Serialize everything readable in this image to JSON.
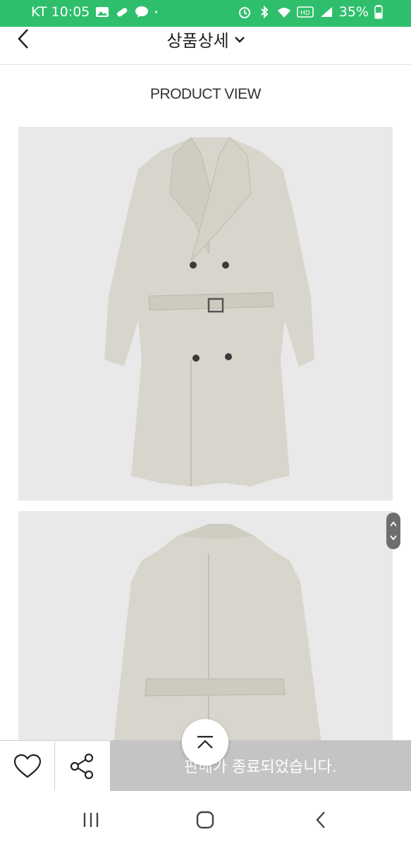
{
  "status_bar": {
    "carrier_time": "KT 10:05",
    "battery": "35%",
    "left_icons": [
      "gallery-icon",
      "pill-icon",
      "kakaotalk-icon",
      "dot-icon"
    ],
    "right_icons": [
      "alarm-icon",
      "bluetooth-icon",
      "wifi-icon",
      "hd-icon",
      "signal-icon",
      "battery-icon"
    ],
    "background": "#2fbf6c"
  },
  "header": {
    "title": "상품상세",
    "back_icon": "chevron-left-icon",
    "dropdown_icon": "chevron-down-icon"
  },
  "main": {
    "section_label": "PRODUCT VIEW",
    "images": [
      {
        "name": "coat-front-image"
      },
      {
        "name": "coat-back-image"
      }
    ]
  },
  "action_bar": {
    "like_icon": "heart-icon",
    "share_icon": "share-icon",
    "sold_out_text": "판매가 종료되었습니다.",
    "sold_out_color": "#c4c4c4"
  },
  "scroll_to_top_icon": "chevron-up-icon",
  "nav_bar": {
    "recents_icon": "recents-icon",
    "home_icon": "home-icon",
    "back_icon": "back-icon"
  }
}
